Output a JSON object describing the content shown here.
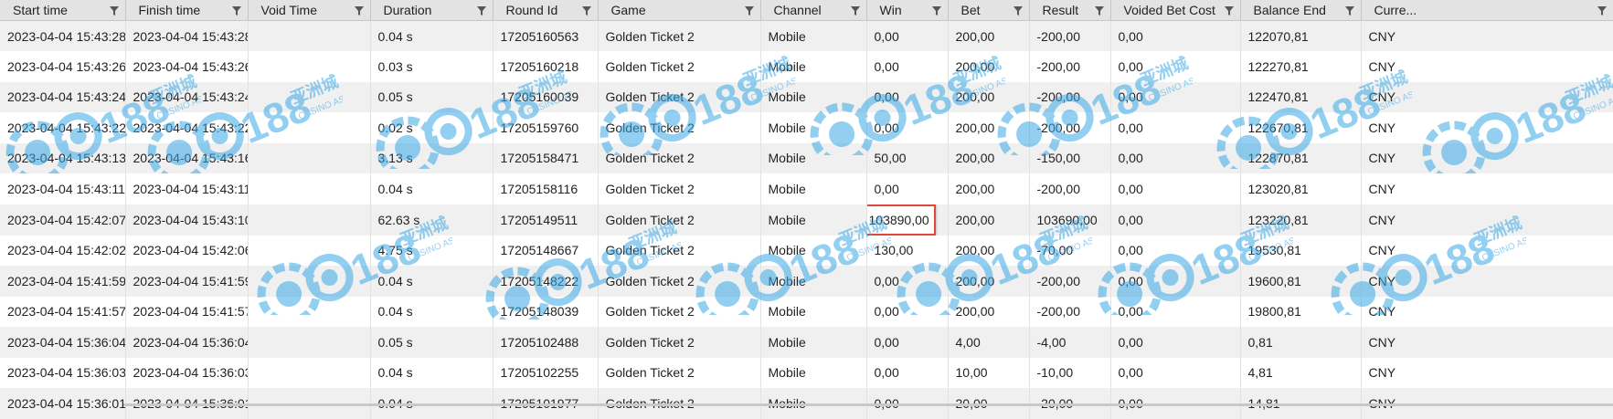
{
  "columns": [
    {
      "label": "Start time",
      "filter_icon": "filter-icon"
    },
    {
      "label": "Finish time",
      "filter_icon": "filter-icon"
    },
    {
      "label": "Void Time",
      "filter_icon": "filter-icon"
    },
    {
      "label": "Duration",
      "filter_icon": "filter-icon"
    },
    {
      "label": "Round Id",
      "filter_icon": "filter-icon"
    },
    {
      "label": "Game",
      "filter_icon": "filter-icon"
    },
    {
      "label": "Channel",
      "filter_icon": "filter-icon"
    },
    {
      "label": "Win",
      "filter_icon": "filter-icon"
    },
    {
      "label": "Bet",
      "filter_icon": "filter-icon"
    },
    {
      "label": "Result",
      "filter_icon": "filter-icon"
    },
    {
      "label": "Voided Bet Cost",
      "filter_icon": "filter-icon"
    },
    {
      "label": "Balance End",
      "filter_icon": "filter-icon"
    },
    {
      "label": "Curre...",
      "filter_icon": "filter-icon"
    }
  ],
  "rows": [
    [
      "2023-04-04 15:43:28",
      "2023-04-04 15:43:28",
      "",
      "0.04 s",
      "17205160563",
      "Golden Ticket 2",
      "Mobile",
      "0,00",
      "200,00",
      "-200,00",
      "0,00",
      "122070,81",
      "CNY"
    ],
    [
      "2023-04-04 15:43:26",
      "2023-04-04 15:43:26",
      "",
      "0.03 s",
      "17205160218",
      "Golden Ticket 2",
      "Mobile",
      "0,00",
      "200,00",
      "-200,00",
      "0,00",
      "122270,81",
      "CNY"
    ],
    [
      "2023-04-04 15:43:24",
      "2023-04-04 15:43:24",
      "",
      "0.05 s",
      "17205160039",
      "Golden Ticket 2",
      "Mobile",
      "0,00",
      "200,00",
      "-200,00",
      "0,00",
      "122470,81",
      "CNY"
    ],
    [
      "2023-04-04 15:43:22",
      "2023-04-04 15:43:22",
      "",
      "0.02 s",
      "17205159760",
      "Golden Ticket 2",
      "Mobile",
      "0,00",
      "200,00",
      "-200,00",
      "0,00",
      "122670,81",
      "CNY"
    ],
    [
      "2023-04-04 15:43:13",
      "2023-04-04 15:43:16",
      "",
      "3.13 s",
      "17205158471",
      "Golden Ticket 2",
      "Mobile",
      "50,00",
      "200,00",
      "-150,00",
      "0,00",
      "122870,81",
      "CNY"
    ],
    [
      "2023-04-04 15:43:11",
      "2023-04-04 15:43:11",
      "",
      "0.04 s",
      "17205158116",
      "Golden Ticket 2",
      "Mobile",
      "0,00",
      "200,00",
      "-200,00",
      "0,00",
      "123020,81",
      "CNY"
    ],
    [
      "2023-04-04 15:42:07",
      "2023-04-04 15:43:10",
      "",
      "62.63 s",
      "17205149511",
      "Golden Ticket 2",
      "Mobile",
      "103890,00",
      "200,00",
      "103690,00",
      "0,00",
      "123220,81",
      "CNY"
    ],
    [
      "2023-04-04 15:42:02",
      "2023-04-04 15:42:06",
      "",
      "4.75 s",
      "17205148667",
      "Golden Ticket 2",
      "Mobile",
      "130,00",
      "200,00",
      "-70,00",
      "0,00",
      "19530,81",
      "CNY"
    ],
    [
      "2023-04-04 15:41:59",
      "2023-04-04 15:41:59",
      "",
      "0.04 s",
      "17205148222",
      "Golden Ticket 2",
      "Mobile",
      "0,00",
      "200,00",
      "-200,00",
      "0,00",
      "19600,81",
      "CNY"
    ],
    [
      "2023-04-04 15:41:57",
      "2023-04-04 15:41:57",
      "",
      "0.04 s",
      "17205148039",
      "Golden Ticket 2",
      "Mobile",
      "0,00",
      "200,00",
      "-200,00",
      "0,00",
      "19800,81",
      "CNY"
    ],
    [
      "2023-04-04 15:36:04",
      "2023-04-04 15:36:04",
      "",
      "0.05 s",
      "17205102488",
      "Golden Ticket 2",
      "Mobile",
      "0,00",
      "4,00",
      "-4,00",
      "0,00",
      "0,81",
      "CNY"
    ],
    [
      "2023-04-04 15:36:03",
      "2023-04-04 15:36:03",
      "",
      "0.04 s",
      "17205102255",
      "Golden Ticket 2",
      "Mobile",
      "0,00",
      "10,00",
      "-10,00",
      "0,00",
      "4,81",
      "CNY"
    ],
    [
      "2023-04-04 15:36:01",
      "2023-04-04 15:36:01",
      "",
      "0.04 s",
      "17205101977",
      "Golden Ticket 2",
      "Mobile",
      "0,00",
      "20,00",
      "-20,00",
      "0,00",
      "14,81",
      "CNY"
    ]
  ],
  "highlight": {
    "row": 6,
    "col": 7,
    "color": "#e0483a"
  },
  "watermark": {
    "logo": "CQ188",
    "cn": "亚洲城",
    "en": "CASINO ASIA",
    "color": "#3aa8e6"
  },
  "colors": {
    "header_bg": "#e3e3e3",
    "row_alt_bg": "#f0f0f0"
  }
}
